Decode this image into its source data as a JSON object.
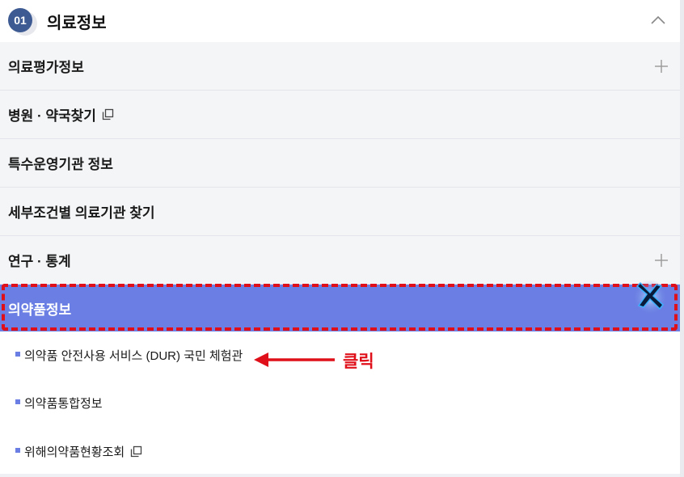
{
  "header": {
    "badge": "01",
    "title": "의료정보",
    "collapse_icon": "chevron-up-icon"
  },
  "menu": {
    "items": [
      {
        "label": "의료평가정보",
        "trailing_icon": "plus-icon"
      },
      {
        "label": "병원 · 약국찾기",
        "trailing_icon": "external-link-icon"
      },
      {
        "label": "특수운영기관 정보"
      },
      {
        "label": "세부조건별 의료기관 찾기"
      },
      {
        "label": "연구 · 통계",
        "trailing_icon": "plus-icon"
      }
    ],
    "active": {
      "label": "의약품정보",
      "cursor_icon": "cursor-icon"
    },
    "subitems": [
      {
        "label": "의약품 안전사용 서비스 (DUR) 국민 체험관"
      },
      {
        "label": "의약품통합정보"
      },
      {
        "label": "위해의약품현황조회",
        "trailing_icon": "external-link-icon"
      }
    ]
  },
  "annotation": {
    "note": "클릭",
    "color": "#e0101a"
  },
  "colors": {
    "accent": "#6a7ee3",
    "badge": "#3d5a93",
    "row_bg": "#f4f5f7"
  }
}
